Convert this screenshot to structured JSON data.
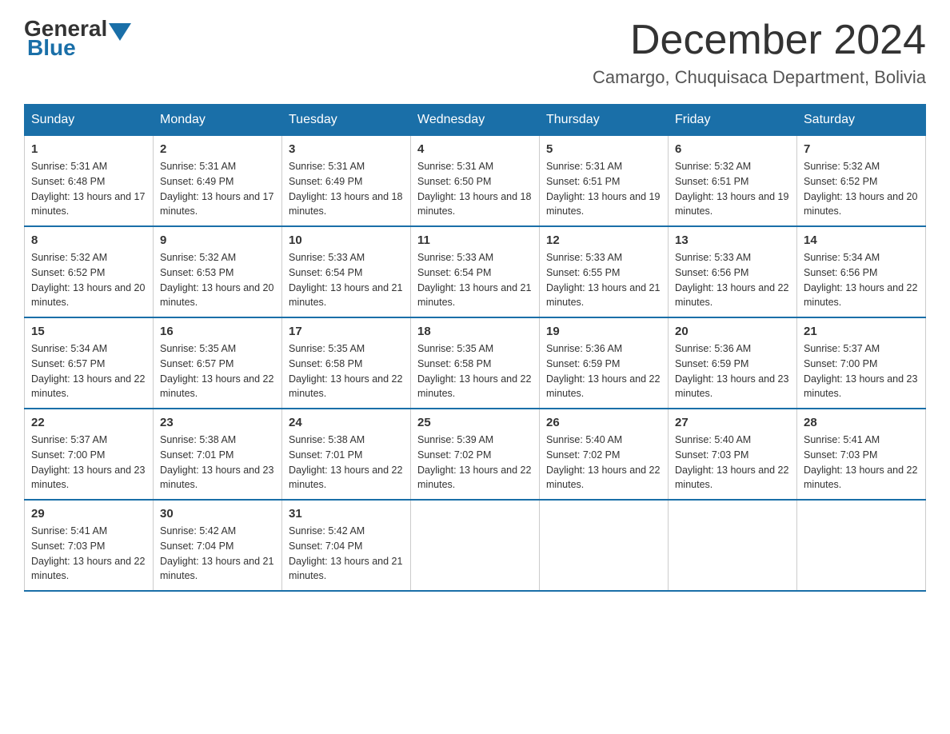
{
  "header": {
    "logo": {
      "general": "General",
      "blue": "Blue"
    },
    "title": "December 2024",
    "subtitle": "Camargo, Chuquisaca Department, Bolivia"
  },
  "days_of_week": [
    "Sunday",
    "Monday",
    "Tuesday",
    "Wednesday",
    "Thursday",
    "Friday",
    "Saturday"
  ],
  "weeks": [
    [
      {
        "num": "1",
        "sunrise": "5:31 AM",
        "sunset": "6:48 PM",
        "daylight": "13 hours and 17 minutes."
      },
      {
        "num": "2",
        "sunrise": "5:31 AM",
        "sunset": "6:49 PM",
        "daylight": "13 hours and 17 minutes."
      },
      {
        "num": "3",
        "sunrise": "5:31 AM",
        "sunset": "6:49 PM",
        "daylight": "13 hours and 18 minutes."
      },
      {
        "num": "4",
        "sunrise": "5:31 AM",
        "sunset": "6:50 PM",
        "daylight": "13 hours and 18 minutes."
      },
      {
        "num": "5",
        "sunrise": "5:31 AM",
        "sunset": "6:51 PM",
        "daylight": "13 hours and 19 minutes."
      },
      {
        "num": "6",
        "sunrise": "5:32 AM",
        "sunset": "6:51 PM",
        "daylight": "13 hours and 19 minutes."
      },
      {
        "num": "7",
        "sunrise": "5:32 AM",
        "sunset": "6:52 PM",
        "daylight": "13 hours and 20 minutes."
      }
    ],
    [
      {
        "num": "8",
        "sunrise": "5:32 AM",
        "sunset": "6:52 PM",
        "daylight": "13 hours and 20 minutes."
      },
      {
        "num": "9",
        "sunrise": "5:32 AM",
        "sunset": "6:53 PM",
        "daylight": "13 hours and 20 minutes."
      },
      {
        "num": "10",
        "sunrise": "5:33 AM",
        "sunset": "6:54 PM",
        "daylight": "13 hours and 21 minutes."
      },
      {
        "num": "11",
        "sunrise": "5:33 AM",
        "sunset": "6:54 PM",
        "daylight": "13 hours and 21 minutes."
      },
      {
        "num": "12",
        "sunrise": "5:33 AM",
        "sunset": "6:55 PM",
        "daylight": "13 hours and 21 minutes."
      },
      {
        "num": "13",
        "sunrise": "5:33 AM",
        "sunset": "6:56 PM",
        "daylight": "13 hours and 22 minutes."
      },
      {
        "num": "14",
        "sunrise": "5:34 AM",
        "sunset": "6:56 PM",
        "daylight": "13 hours and 22 minutes."
      }
    ],
    [
      {
        "num": "15",
        "sunrise": "5:34 AM",
        "sunset": "6:57 PM",
        "daylight": "13 hours and 22 minutes."
      },
      {
        "num": "16",
        "sunrise": "5:35 AM",
        "sunset": "6:57 PM",
        "daylight": "13 hours and 22 minutes."
      },
      {
        "num": "17",
        "sunrise": "5:35 AM",
        "sunset": "6:58 PM",
        "daylight": "13 hours and 22 minutes."
      },
      {
        "num": "18",
        "sunrise": "5:35 AM",
        "sunset": "6:58 PM",
        "daylight": "13 hours and 22 minutes."
      },
      {
        "num": "19",
        "sunrise": "5:36 AM",
        "sunset": "6:59 PM",
        "daylight": "13 hours and 22 minutes."
      },
      {
        "num": "20",
        "sunrise": "5:36 AM",
        "sunset": "6:59 PM",
        "daylight": "13 hours and 23 minutes."
      },
      {
        "num": "21",
        "sunrise": "5:37 AM",
        "sunset": "7:00 PM",
        "daylight": "13 hours and 23 minutes."
      }
    ],
    [
      {
        "num": "22",
        "sunrise": "5:37 AM",
        "sunset": "7:00 PM",
        "daylight": "13 hours and 23 minutes."
      },
      {
        "num": "23",
        "sunrise": "5:38 AM",
        "sunset": "7:01 PM",
        "daylight": "13 hours and 23 minutes."
      },
      {
        "num": "24",
        "sunrise": "5:38 AM",
        "sunset": "7:01 PM",
        "daylight": "13 hours and 22 minutes."
      },
      {
        "num": "25",
        "sunrise": "5:39 AM",
        "sunset": "7:02 PM",
        "daylight": "13 hours and 22 minutes."
      },
      {
        "num": "26",
        "sunrise": "5:40 AM",
        "sunset": "7:02 PM",
        "daylight": "13 hours and 22 minutes."
      },
      {
        "num": "27",
        "sunrise": "5:40 AM",
        "sunset": "7:03 PM",
        "daylight": "13 hours and 22 minutes."
      },
      {
        "num": "28",
        "sunrise": "5:41 AM",
        "sunset": "7:03 PM",
        "daylight": "13 hours and 22 minutes."
      }
    ],
    [
      {
        "num": "29",
        "sunrise": "5:41 AM",
        "sunset": "7:03 PM",
        "daylight": "13 hours and 22 minutes."
      },
      {
        "num": "30",
        "sunrise": "5:42 AM",
        "sunset": "7:04 PM",
        "daylight": "13 hours and 21 minutes."
      },
      {
        "num": "31",
        "sunrise": "5:42 AM",
        "sunset": "7:04 PM",
        "daylight": "13 hours and 21 minutes."
      },
      null,
      null,
      null,
      null
    ]
  ]
}
